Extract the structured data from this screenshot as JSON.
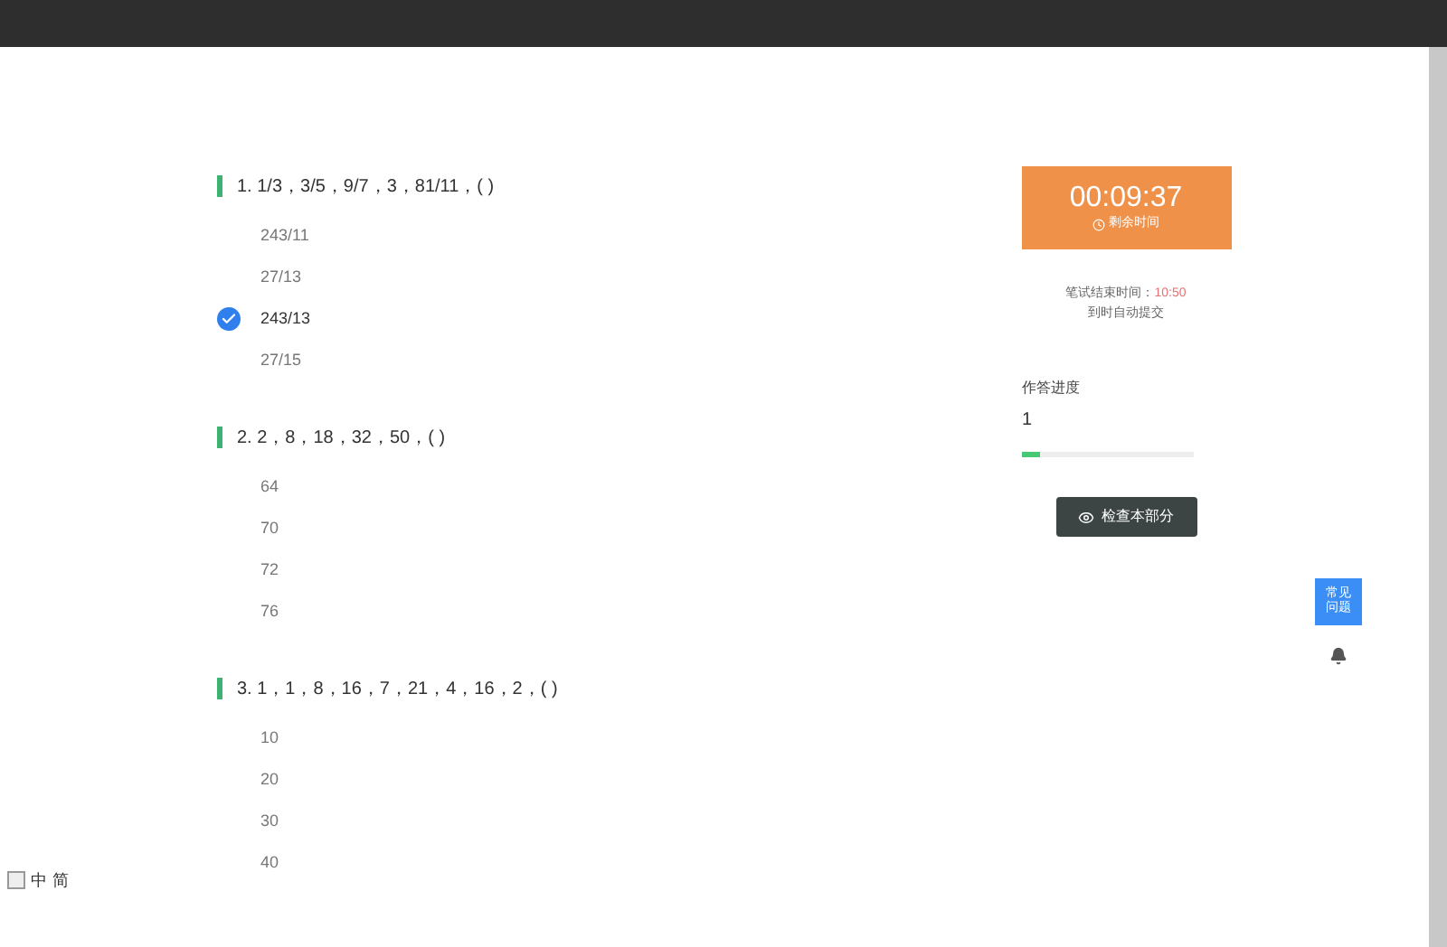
{
  "questions": [
    {
      "title": "1. 1/3，3/5，9/7，3，81/11，( )",
      "options": [
        {
          "label": "243/11",
          "selected": false
        },
        {
          "label": "27/13",
          "selected": false
        },
        {
          "label": "243/13",
          "selected": true
        },
        {
          "label": "27/15",
          "selected": false
        }
      ]
    },
    {
      "title": "2. 2，8，18，32，50，( )",
      "options": [
        {
          "label": "64",
          "selected": false
        },
        {
          "label": "70",
          "selected": false
        },
        {
          "label": "72",
          "selected": false
        },
        {
          "label": "76",
          "selected": false
        }
      ]
    },
    {
      "title": "3. 1，1，8，16，7，21，4，16，2，( )",
      "options": [
        {
          "label": "10",
          "selected": false
        },
        {
          "label": "20",
          "selected": false
        },
        {
          "label": "30",
          "selected": false
        },
        {
          "label": "40",
          "selected": false
        }
      ]
    }
  ],
  "timer": {
    "time": "00:09:37",
    "label": "剩余时间"
  },
  "end_time": {
    "label": "笔试结束时间：",
    "value": "10:50",
    "note": "到时自动提交"
  },
  "progress": {
    "label": "作答进度",
    "count": "1",
    "level": 0.1
  },
  "check_button": "检查本部分",
  "help_button": "常见问题",
  "ime_bar": [
    "中",
    "简"
  ]
}
